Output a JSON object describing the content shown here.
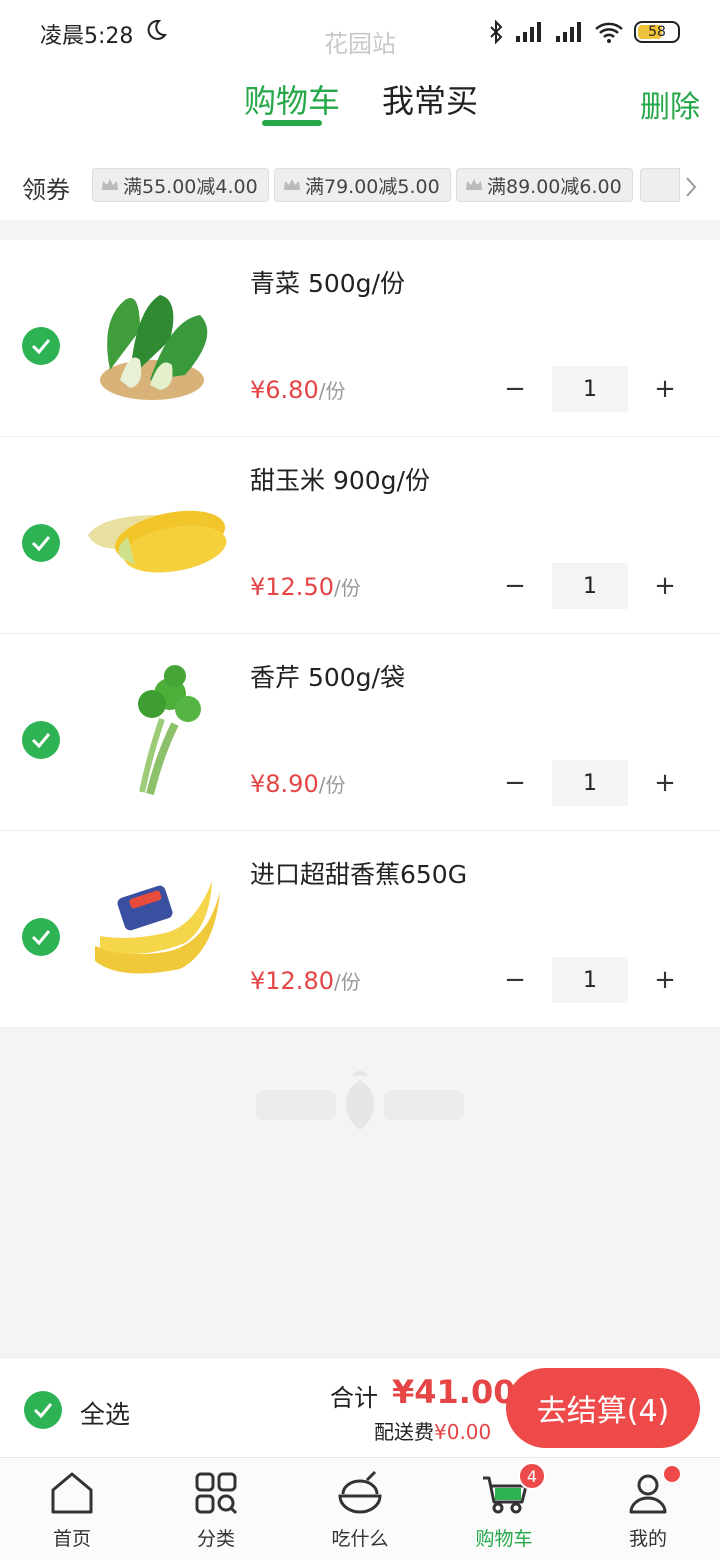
{
  "status_bar": {
    "time": "凌晨5:28",
    "station": "花园站",
    "battery": "58"
  },
  "header": {
    "tab_cart": "购物车",
    "tab_often": "我常买",
    "delete_label": "删除"
  },
  "coupons": {
    "label": "领券",
    "items": [
      "满55.00减4.00",
      "满79.00减5.00",
      "满89.00减6.00"
    ]
  },
  "cart": {
    "items": [
      {
        "name": "青菜 500g/份",
        "price": "¥6.80",
        "unit": "/份",
        "qty": "1",
        "image": "bok-choy"
      },
      {
        "name": "甜玉米 900g/份",
        "price": "¥12.50",
        "unit": "/份",
        "qty": "1",
        "image": "sweet-corn"
      },
      {
        "name": "香芹 500g/袋",
        "price": "¥8.90",
        "unit": "/份",
        "qty": "1",
        "image": "celery"
      },
      {
        "name": "进口超甜香蕉650G",
        "price": "¥12.80",
        "unit": "/份",
        "qty": "1",
        "image": "bananas"
      }
    ],
    "minus": "−",
    "plus": "+"
  },
  "checkout": {
    "select_all": "全选",
    "total_label": "合计",
    "total_value": "¥41.00",
    "delivery_label": "配送费",
    "delivery_fee": "¥0.00",
    "button": "去结算(4)"
  },
  "tabbar": {
    "items": [
      {
        "label": "首页",
        "icon": "home-icon"
      },
      {
        "label": "分类",
        "icon": "category-icon"
      },
      {
        "label": "吃什么",
        "icon": "bowl-icon"
      },
      {
        "label": "购物车",
        "icon": "cart-icon",
        "badge": "4",
        "active": true
      },
      {
        "label": "我的",
        "icon": "profile-icon"
      }
    ]
  },
  "colors": {
    "accent": "#26a84a",
    "price": "#e64545",
    "checkout": "#ef4a4a"
  }
}
